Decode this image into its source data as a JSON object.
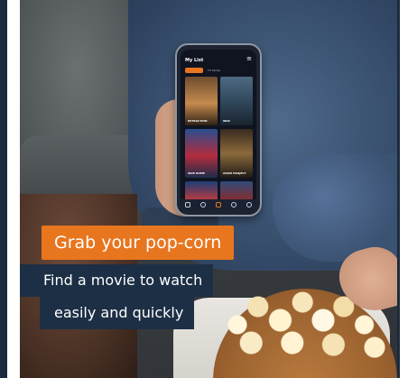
{
  "promo": {
    "headline": "Grab your pop-corn",
    "line1": "Find a movie to watch",
    "line2": "easily and quickly"
  },
  "phone_app": {
    "title": "My List",
    "menu_icon": "hamburger-icon",
    "tabs": [
      "",
      "TV Series"
    ],
    "posters": [
      {
        "label": "EXTRACTION"
      },
      {
        "label": "WAR"
      },
      {
        "label": "SIDE DOME"
      },
      {
        "label": "ADAM PROJECT"
      },
      {
        "label": ""
      },
      {
        "label": ""
      }
    ],
    "nav_icons": [
      "home-icon",
      "settings-icon",
      "list-icon",
      "search-icon",
      "profile-icon"
    ]
  },
  "colors": {
    "accent_orange": "#e8761f",
    "navy": "#1c2f45",
    "frame_dark": "#1b2a3c"
  }
}
